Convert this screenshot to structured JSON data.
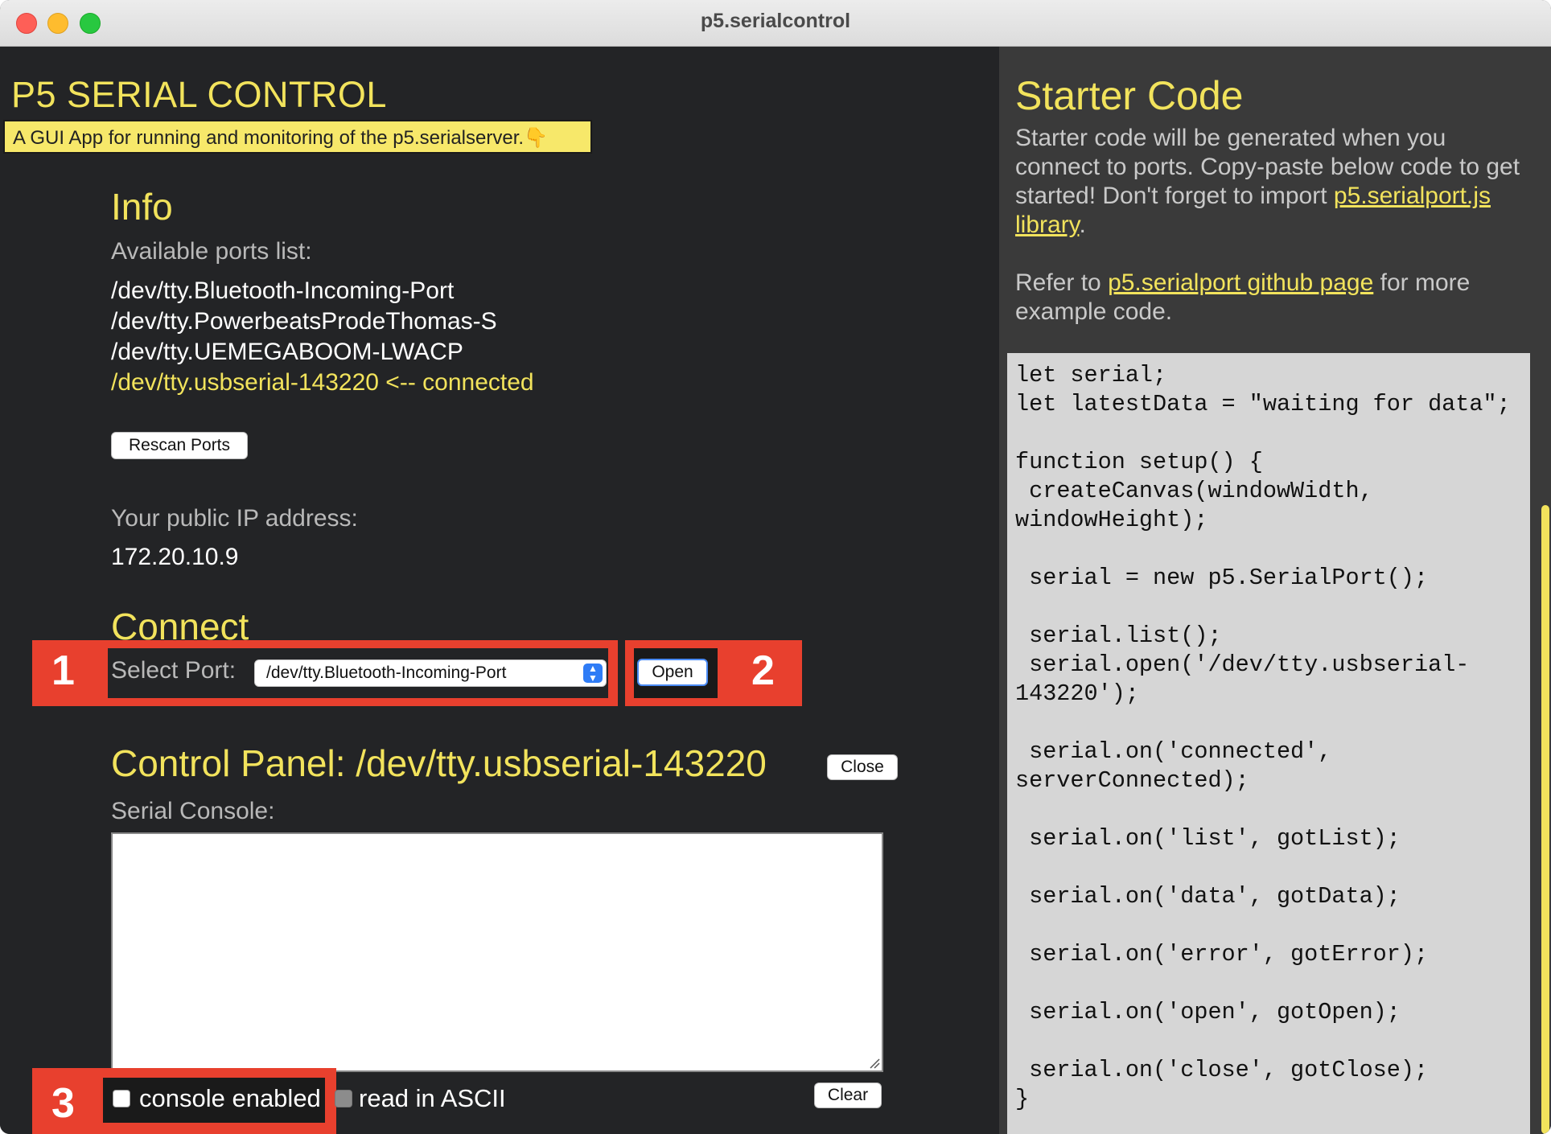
{
  "window": {
    "title": "p5.serialcontrol"
  },
  "header": {
    "app_title": "P5 SERIAL CONTROL",
    "subtitle": "A GUI App for running and monitoring of the p5.serialserver.👇"
  },
  "info": {
    "heading": "Info",
    "ports_label": "Available ports list:",
    "ports": [
      "/dev/tty.Bluetooth-Incoming-Port",
      "/dev/tty.PowerbeatsProdeThomas-S",
      "/dev/tty.UEMEGABOOM-LWACP",
      "/dev/tty.usbserial-143220 <-- connected"
    ],
    "rescan_label": "Rescan Ports",
    "ip_label": "Your public IP address:",
    "ip_value": "172.20.10.9"
  },
  "connect": {
    "heading": "Connect",
    "select_label": "Select Port:",
    "selected_port": "/dev/tty.Bluetooth-Incoming-Port",
    "open_label": "Open"
  },
  "annotations": {
    "one": "1",
    "two": "2",
    "three": "3"
  },
  "control_panel": {
    "heading": "Control Panel: /dev/tty.usbserial-143220",
    "close_label": "Close",
    "console_label": "Serial Console:",
    "console_value": "",
    "console_enabled_label": "console enabled",
    "console_enabled_checked": false,
    "ascii_label": "read in ASCII",
    "clear_label": "Clear"
  },
  "starter": {
    "heading": "Starter Code",
    "para1_text": "Starter code will be generated when you connect to ports. Copy-paste below code to get started! Don't forget to import ",
    "para1_link": "p5.serialport.js library",
    "para1_end": ".",
    "para2_start": "Refer to ",
    "para2_link": "p5.serialport github page",
    "para2_end": " for more example code.",
    "code": "let serial;\nlet latestData = \"waiting for data\";\n\nfunction setup() {\n createCanvas(windowWidth, windowHeight);\n\n serial = new p5.SerialPort();\n\n serial.list();\n serial.open('/dev/tty.usbserial-143220');\n\n serial.on('connected', serverConnected);\n\n serial.on('list', gotList);\n\n serial.on('data', gotData);\n\n serial.on('error', gotError);\n\n serial.on('open', gotOpen);\n\n serial.on('close', gotClose);\n}"
  },
  "colors": {
    "accent_yellow": "#f2e35c",
    "annotation_red": "#e8402e",
    "panel_dark": "#232426",
    "panel_right": "#3a3a3a"
  }
}
